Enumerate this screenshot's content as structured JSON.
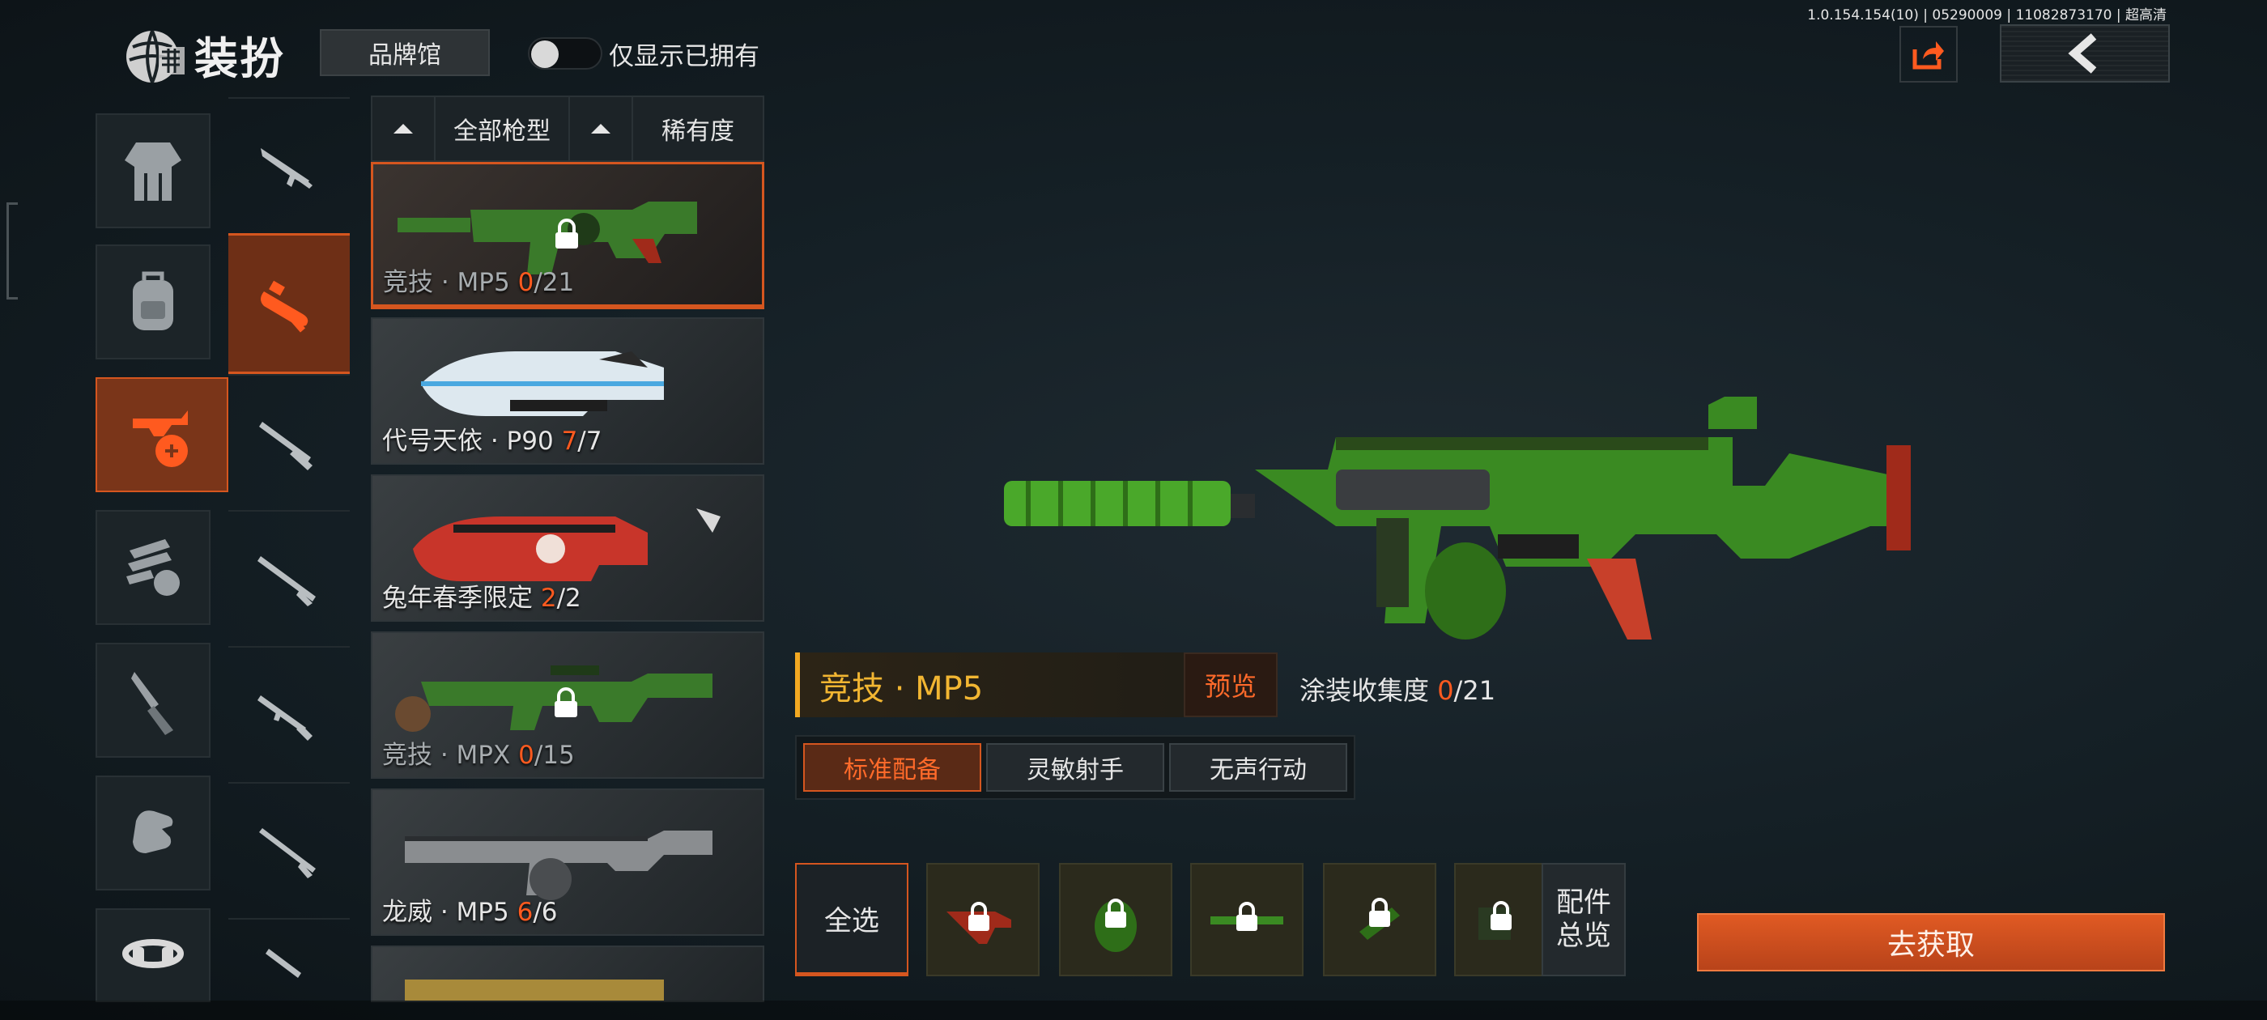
{
  "header": {
    "title": "装扮",
    "brand_button": "品牌馆",
    "owned_toggle_label": "仅显示已拥有",
    "owned_toggle_on": false,
    "version": "1.0.154.154(10) | 05290009 | 11082873170 | 超高清"
  },
  "categories": [
    {
      "icon": "outfit-icon",
      "active": false
    },
    {
      "icon": "backpack-icon",
      "active": false
    },
    {
      "icon": "weapon-skin-icon",
      "active": true
    },
    {
      "icon": "parachute-icon",
      "active": false
    },
    {
      "icon": "knife-icon",
      "active": false
    },
    {
      "icon": "glove-icon",
      "active": false
    },
    {
      "icon": "headset-icon",
      "active": false
    }
  ],
  "weapon_types": [
    {
      "icon": "assault-rifle-icon",
      "active": false
    },
    {
      "icon": "smg-icon",
      "active": true
    },
    {
      "icon": "shotgun-icon",
      "active": false
    },
    {
      "icon": "sniper-rifle-icon",
      "active": false
    },
    {
      "icon": "rifle-icon",
      "active": false
    },
    {
      "icon": "bolt-rifle-icon",
      "active": false
    },
    {
      "icon": "pistol-icon",
      "active": false
    }
  ],
  "sort": {
    "all_types": "全部枪型",
    "rarity": "稀有度"
  },
  "skins": [
    {
      "name": "竞技 · MP5",
      "current": "0",
      "total": "/21",
      "locked": true,
      "active": true,
      "tint": "#3a7a2a"
    },
    {
      "name": "代号天依 · P90",
      "current": "7",
      "total": "/7",
      "locked": false,
      "active": false,
      "tint": "#9ec9e8"
    },
    {
      "name": "兔年春季限定",
      "current": "2",
      "total": "/2",
      "locked": false,
      "active": false,
      "tint": "#c8352a"
    },
    {
      "name": "竞技 · MPX",
      "current": "0",
      "total": "/15",
      "locked": true,
      "active": false,
      "tint": "#3a7a2a"
    },
    {
      "name": "龙威 · MP5",
      "current": "6",
      "total": "/6",
      "locked": false,
      "active": false,
      "tint": "#6a6a6a"
    }
  ],
  "detail": {
    "weapon_name": "竞技 · MP5",
    "preview_button": "预览",
    "collection_label": "涂装收集度",
    "collection_current": "0",
    "collection_total": "/21",
    "loadouts": [
      {
        "label": "标准配备",
        "active": true
      },
      {
        "label": "灵敏射手",
        "active": false
      },
      {
        "label": "无声行动",
        "active": false
      }
    ],
    "select_all": "全选",
    "attachments": [
      {
        "icon": "stock-attachment-icon",
        "locked": true
      },
      {
        "icon": "magazine-attachment-icon",
        "locked": true
      },
      {
        "icon": "barrel-attachment-icon",
        "locked": true
      },
      {
        "icon": "grip-attachment-icon",
        "locked": true
      },
      {
        "icon": "scope-attachment-icon",
        "locked": true
      }
    ],
    "attachments_overview_line1": "配件",
    "attachments_overview_line2": "总览",
    "acquire_button": "去获取"
  },
  "colors": {
    "accent": "#d5561f",
    "gold": "#f2b632",
    "highlight": "#ff5a1f"
  }
}
